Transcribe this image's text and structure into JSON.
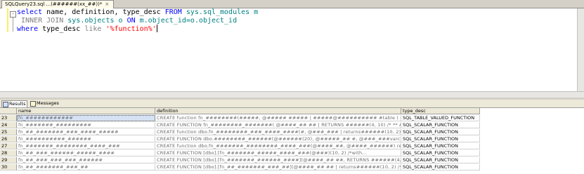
{
  "document_tab": {
    "title": "SQLQuery23.sql ...(######(xx_##))*",
    "close": "×"
  },
  "editor": {
    "lines": [
      {
        "s1": "select",
        "s2": " name, definition, type_desc ",
        "s3": "FROM",
        "s4": " sys.sql_modules m"
      },
      {
        "s1": "INNER JOIN",
        "s2": " sys.objects o ",
        "s3": "ON",
        "s4": " m.object_id=o.object_id"
      },
      {
        "s1": "where",
        "s2": " type_desc ",
        "s3": "like",
        "s4": "'%function%'"
      }
    ],
    "outline_symbol": "-"
  },
  "results_tabs": [
    {
      "label": "Results"
    },
    {
      "label": "Messages"
    }
  ],
  "grid": {
    "columns": [
      "name",
      "definition",
      "type_desc"
    ],
    "rows": [
      {
        "num": "23",
        "name": "fn_############",
        "definition": "CREATE      function fn_########(#####, @##### ##### | #####@########## #table (   cont_i...",
        "type_desc": "SQL_TABLE_VALUED_FUNCTION"
      },
      {
        "num": "24",
        "name": "fn_#######_#########",
        "definition": "CREATE      FUNCTION fn_########_#######(  @####_## ## | RETURNS ######(4, 10)  /* ** Author: drebe...",
        "type_desc": "SQL_SCALAR_FUNCTION"
      },
      {
        "num": "25",
        "name": "fn_##_#######_###_####_#####",
        "definition": "CREATE          function dbo.fn_########_###_####_####(#, @###_### | returns######(10, 2)  /*with en...",
        "type_desc": "SQL_SCALAR_FUNCTION"
      },
      {
        "num": "26",
        "name": "fn_##########_######",
        "definition": "CREATE      FUNCTION dbo.########_######(@######(20),      @#####_## #, @###_###varchar(20), ...",
        "type_desc": "SQL_SCALAR_FUNCTION"
      },
      {
        "num": "27",
        "name": "fn_#######_########_####_###",
        "definition": "CREATE      function dbo.fn_#######_########_####_###(@####_##, @####_######) returns decimal(10, 2) ...",
        "type_desc": "SQL_SCALAR_FUNCTION"
      },
      {
        "num": "28",
        "name": "fn_##_###_######_#####_####",
        "definition": "CREATE      FUNCTION [dbo].[fn_#######_#####_####_###(@###)(10, 2)  /*with...",
        "type_desc": "SQL_SCALAR_FUNCTION"
      },
      {
        "num": "29",
        "name": "fn_##_###_###_###_######",
        "definition": "CREATE   FUNCTION [dbo].[fn_#######_######_####](@####_## ##, RETURNS ######(4, 2)  /* ** Author...",
        "type_desc": "SQL_SCALAR_FUNCTION"
      },
      {
        "num": "30",
        "name": "fn_##_#######_###_##",
        "definition": "CREATE FUNCTION [dbo].[fn_##_#######_###_##](@####_## ## | returns######(10, 2)  /*with encryp...",
        "type_desc": "SQL_SCALAR_FUNCTION"
      }
    ]
  },
  "colors": {
    "keyword": "#0000ff",
    "function": "#ff00ff",
    "string": "#ff0000",
    "operator": "#808080",
    "system_object": "#008080"
  }
}
